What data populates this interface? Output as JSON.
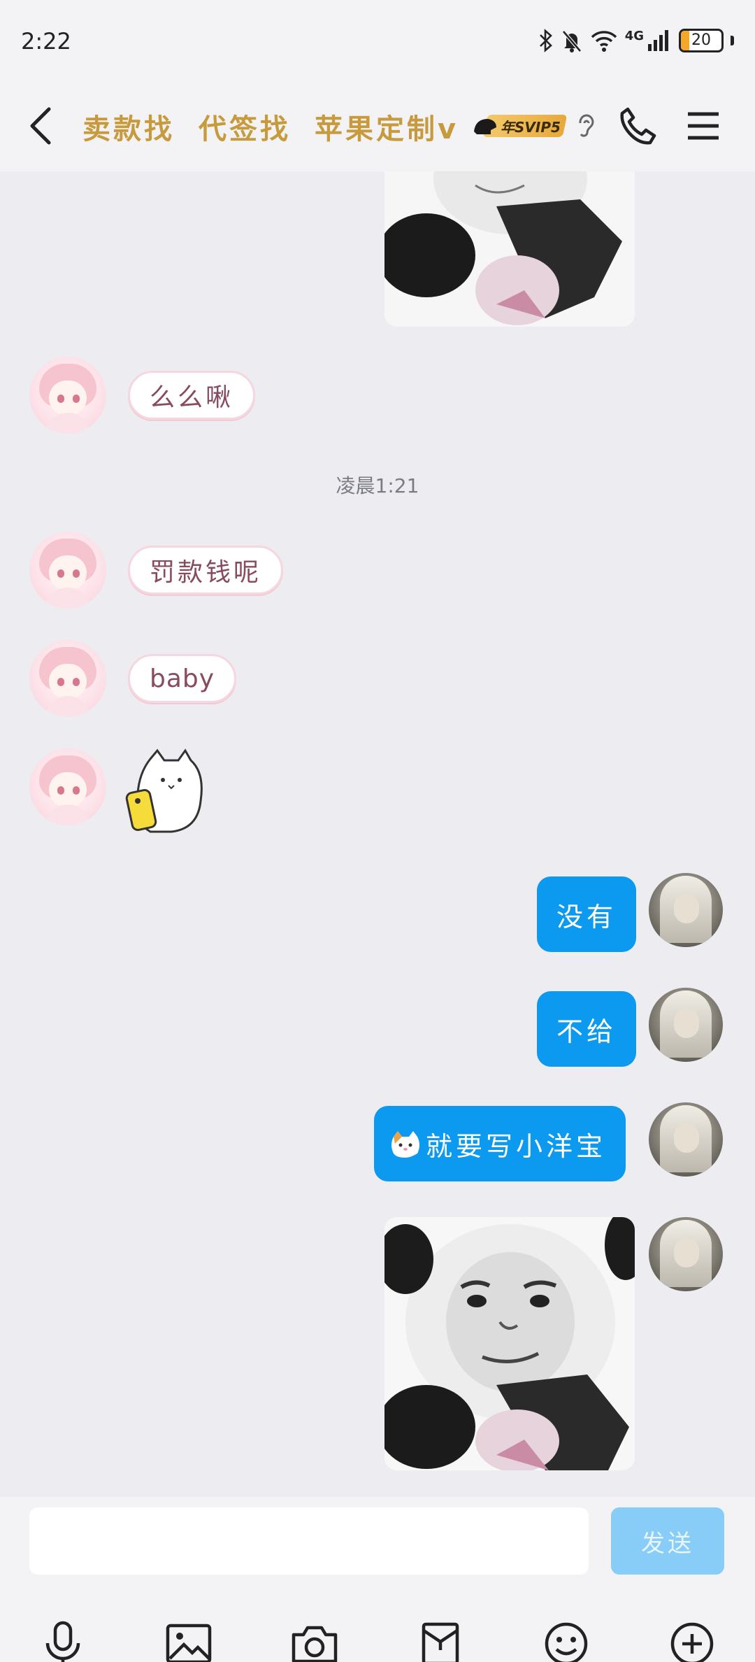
{
  "status_bar": {
    "time": "2:22",
    "battery": "20",
    "network": "4G"
  },
  "header": {
    "title_parts": [
      "卖款找",
      "代签找",
      "苹果定制v"
    ],
    "vip_badge": "年SVIP5"
  },
  "messages": {
    "m1": "么么啾",
    "time_sep": "凌晨1:21",
    "m2": "罚款钱呢",
    "m3": "baby",
    "r1": "没有",
    "r2": "不给",
    "r3": "就要写小洋宝"
  },
  "input": {
    "placeholder": "",
    "send_label": "发送"
  },
  "colors": {
    "accent": "#0c99f0",
    "title": "#c89a3e",
    "send_disabled": "#88ccf8"
  },
  "toolbar_icons": [
    "microphone-icon",
    "image-icon",
    "camera-icon",
    "red-packet-icon",
    "emoji-icon",
    "plus-icon"
  ]
}
